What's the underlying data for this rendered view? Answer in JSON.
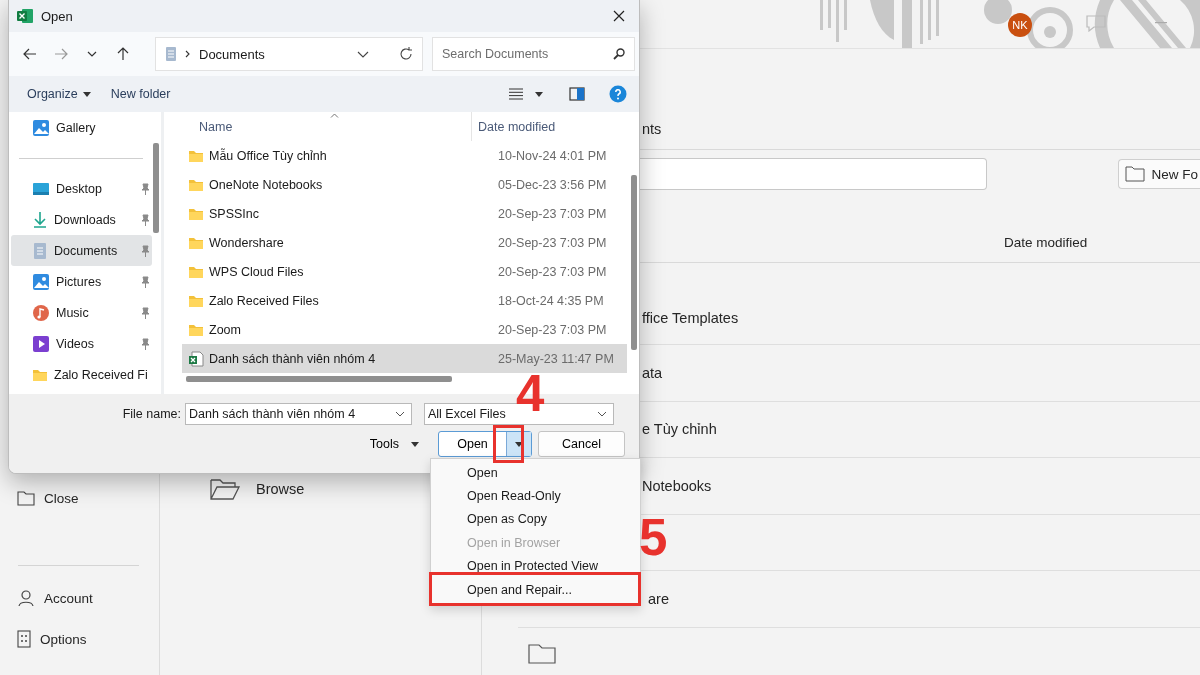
{
  "backstage": {
    "avatar": "NK",
    "nav": [
      {
        "kind": "close",
        "label": "Close"
      },
      {
        "kind": "account",
        "label": "Account"
      },
      {
        "kind": "options",
        "label": "Options"
      }
    ],
    "browse": "Browse",
    "heading": "nts",
    "new_folder_button": "New Fo",
    "column_header": "Date modified",
    "rows": [
      {
        "kind": "text",
        "name": "ffice Templates"
      },
      {
        "kind": "text",
        "name": "ata"
      },
      {
        "kind": "text",
        "name": "e Tùy chỉnh"
      },
      {
        "kind": "text",
        "name": "Notebooks"
      },
      {
        "kind": "empty"
      },
      {
        "kind": "text",
        "name": "are"
      },
      {
        "kind": "icon"
      }
    ]
  },
  "dialog": {
    "title": "Open",
    "path": "Documents",
    "search_placeholder": "Search Documents",
    "commands": [
      "Organize",
      "New folder"
    ],
    "sidebar": [
      {
        "kind": "gallery",
        "label": "Gallery",
        "pinned": false,
        "selected": false
      },
      {
        "kind": "desktop",
        "label": "Desktop",
        "pinned": true,
        "selected": false
      },
      {
        "kind": "downloads",
        "label": "Downloads",
        "pinned": true,
        "selected": false
      },
      {
        "kind": "documents",
        "label": "Documents",
        "pinned": true,
        "selected": true
      },
      {
        "kind": "pictures",
        "label": "Pictures",
        "pinned": true,
        "selected": false
      },
      {
        "kind": "music",
        "label": "Music",
        "pinned": true,
        "selected": false
      },
      {
        "kind": "videos",
        "label": "Videos",
        "pinned": true,
        "selected": false
      },
      {
        "kind": "folder",
        "label": "Zalo Received Fi",
        "pinned": false,
        "selected": false
      }
    ],
    "columns": [
      "Name",
      "Date modified"
    ],
    "files": [
      {
        "kind": "folder",
        "name": "Mẫu Office Tùy chỉnh",
        "date": "10-Nov-24 4:01 PM",
        "selected": false
      },
      {
        "kind": "folder",
        "name": "OneNote Notebooks",
        "date": "05-Dec-23 3:56 PM",
        "selected": false
      },
      {
        "kind": "folder",
        "name": "SPSSInc",
        "date": "20-Sep-23 7:03 PM",
        "selected": false
      },
      {
        "kind": "folder",
        "name": "Wondershare",
        "date": "20-Sep-23 7:03 PM",
        "selected": false
      },
      {
        "kind": "folder",
        "name": "WPS Cloud Files",
        "date": "20-Sep-23 7:03 PM",
        "selected": false
      },
      {
        "kind": "folder",
        "name": "Zalo Received Files",
        "date": "18-Oct-24 4:35 PM",
        "selected": false
      },
      {
        "kind": "folder",
        "name": "Zoom",
        "date": "20-Sep-23 7:03 PM",
        "selected": false
      },
      {
        "kind": "excel",
        "name": "Danh sách thành viên nhóm 4",
        "date": "25-May-23 11:47 PM",
        "selected": true
      }
    ],
    "file_name_label": "File name:",
    "file_name": "Danh sách thành viên nhóm 4",
    "file_type": "All Excel Files",
    "tools": "Tools",
    "open_button": "Open",
    "cancel_button": "Cancel"
  },
  "open_menu": [
    {
      "label": "Open",
      "disabled": false
    },
    {
      "label": "Open Read-Only",
      "disabled": false
    },
    {
      "label": "Open as Copy",
      "disabled": false
    },
    {
      "label": "Open in Browser",
      "disabled": true
    },
    {
      "label": "Open in Protected View",
      "disabled": false
    },
    {
      "label": "Open and Repair...",
      "disabled": false
    }
  ],
  "annotations": [
    {
      "label": "4"
    },
    {
      "label": "5"
    }
  ]
}
